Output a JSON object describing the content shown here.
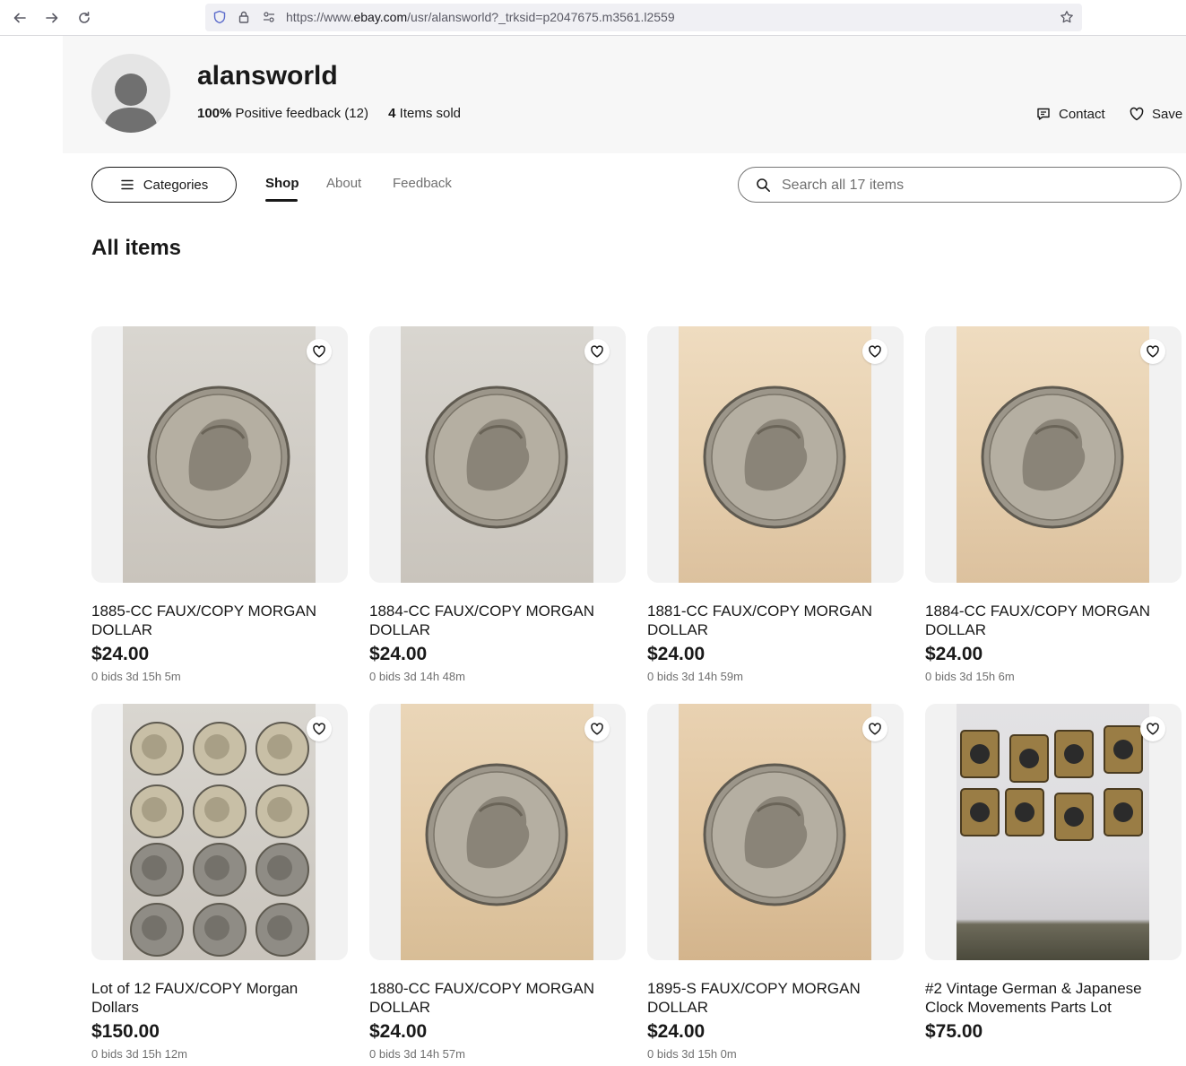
{
  "browser": {
    "url_prefix": "https://www.",
    "url_host": "ebay.com",
    "url_path": "/usr/alansworld?_trksid=p2047675.m3561.l2559"
  },
  "store": {
    "name": "alansworld",
    "feedback_pct": "100%",
    "feedback_label": "Positive feedback (12)",
    "items_sold_count": "4",
    "items_sold_label": "Items sold",
    "contact_label": "Contact",
    "save_label": "Save"
  },
  "nav": {
    "categories_label": "Categories",
    "tabs": [
      {
        "label": "Shop",
        "active": true
      },
      {
        "label": "About",
        "active": false
      },
      {
        "label": "Feedback",
        "active": false
      }
    ],
    "search_placeholder": "Search all 17 items"
  },
  "section_title": "All items",
  "icons": {
    "back": "back-arrow-icon",
    "forward": "forward-arrow-icon",
    "reload": "reload-icon",
    "shield": "shield-icon",
    "lock": "lock-icon",
    "permissions": "permissions-icon",
    "bookmark": "star-icon",
    "contact": "message-icon",
    "save": "heart-icon",
    "menu": "hamburger-icon",
    "search": "search-icon",
    "watch": "heart-icon"
  },
  "colors": {
    "text": "#191919",
    "muted": "#707070",
    "header_bg": "#f7f7f7"
  },
  "items": [
    {
      "title": "1885-CC FAUX/COPY MORGAN DOLLAR",
      "price": "$24.00",
      "meta": "0 bids 3d 15h 5m",
      "photo": "coin",
      "bg": "gray"
    },
    {
      "title": "1884-CC FAUX/COPY MORGAN DOLLAR",
      "price": "$24.00",
      "meta": "0 bids 3d 14h 48m",
      "photo": "coin",
      "bg": "gray"
    },
    {
      "title": "1881-CC FAUX/COPY MORGAN DOLLAR",
      "price": "$24.00",
      "meta": "0 bids 3d 14h 59m",
      "photo": "coin",
      "bg": "tan"
    },
    {
      "title": "1884-CC FAUX/COPY MORGAN DOLLAR",
      "price": "$24.00",
      "meta": "0 bids 3d 15h 6m",
      "photo": "coin",
      "bg": "tan"
    },
    {
      "title": "Lot of 12 FAUX/COPY Morgan Dollars",
      "price": "$150.00",
      "meta": "0 bids 3d 15h 12m",
      "photo": "coin-lot",
      "bg": "gray"
    },
    {
      "title": "1880-CC FAUX/COPY MORGAN DOLLAR",
      "price": "$24.00",
      "meta": "0 bids 3d 14h 57m",
      "photo": "coin",
      "bg": "tan2"
    },
    {
      "title": "1895-S FAUX/COPY MORGAN DOLLAR",
      "price": "$24.00",
      "meta": "0 bids 3d 15h 0m",
      "photo": "coin",
      "bg": "tan3"
    },
    {
      "title": "#2 Vintage German & Japanese Clock Movements Parts Lot",
      "price": "$75.00",
      "meta": "",
      "photo": "clock-parts",
      "bg": "blanket"
    }
  ]
}
